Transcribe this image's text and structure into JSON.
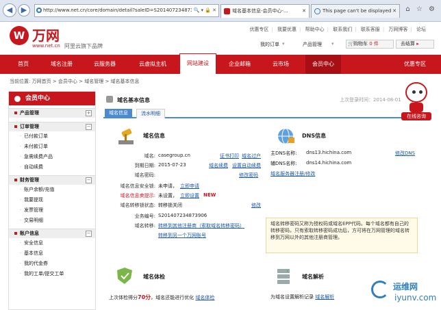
{
  "browser": {
    "url": "http://www.net.cn/core/domain/detail?saleID=S2014072348739",
    "tabs": [
      {
        "label": "域名基本信息-会员中心-..."
      },
      {
        "label": "This page can't be displayed"
      }
    ]
  },
  "header": {
    "brand": "万网",
    "brand_url": "www.net.cn",
    "slogan": "阿里云旗下品牌",
    "top_links": [
      "优惠专区",
      "我要优惠",
      "帮助中心",
      "联系我们",
      "联系客服",
      "万网博客",
      "论坛"
    ],
    "my_order": "我的订单",
    "product_mgmt": "产品管理",
    "cart_label": "购物车",
    "cart_count": "0 件",
    "wallet_label": "去结算"
  },
  "nav": {
    "items": [
      "首页",
      "域名注册",
      "云服务器",
      "云虚拟主机",
      "网站建设",
      "企业邮箱",
      "云市场",
      "会员中心",
      "优惠专区"
    ],
    "active": "网站建设"
  },
  "breadcrumb": "当前位置: 万网首页 > 会员中心 > 域名管理 > 域名基本信息",
  "last_login": "上次登录时间：2014-08-01",
  "sidebar": {
    "title": "会员中心",
    "sections": [
      {
        "label": "产品管理",
        "items": []
      },
      {
        "label": "订单管理",
        "items": [
          "已付款订单",
          "未付款订单",
          "急需续费产品",
          "自动续费"
        ]
      },
      {
        "label": "财务管理",
        "items": [
          "账户余额/充值",
          "我要提现",
          "发票管理",
          "交易明细"
        ]
      },
      {
        "label": "账户信息",
        "items": [
          "安全信息",
          "基本信息",
          "我的代金券",
          "我的工单/提交工单"
        ]
      }
    ]
  },
  "main": {
    "title": "域名基本信息",
    "tabs": [
      "域名信息",
      "流水明细"
    ],
    "domain_panel": {
      "title": "域名信息",
      "rows": [
        {
          "label": "域名:",
          "value": "casegroup.cn"
        },
        {
          "label": "到期日期:",
          "value": "2015-07-23"
        },
        {
          "label": "域名密码:",
          "value": ""
        },
        {
          "label": "域名信息安全锁:",
          "value": "未申请，"
        },
        {
          "label": "域名信息卖提示:",
          "value": "未设置，"
        },
        {
          "label": "域名转移锁状态:",
          "value": "转移锁关闭"
        },
        {
          "label": "业务编号:",
          "value": "S201407234873906"
        },
        {
          "label": "域名转移:",
          "value": ""
        }
      ],
      "links": {
        "cert_print": "证书打印",
        "domain_holder": "域名过户",
        "renew": "域名续费",
        "auto_renew": "设置自动续费",
        "modify_pwd": "修改密码",
        "apply_now": "立即申请",
        "set_now": "立即设置",
        "new_badge": "NEW",
        "modify": "修改",
        "transfer_out": "转移到其他注册商（索取域名转移密码）",
        "transfer_account": "转移到另一个万网账号"
      }
    },
    "dns_panel": {
      "title": "DNS信息",
      "main_dns_label": "主DNS名称:",
      "main_dns": "dns13.hichina.com",
      "aux_dns_label": "辅DNS名称:",
      "aux_dns": "dns14.hichina.com",
      "modify_dns": "修改DNS",
      "server_status": "域名服务器注册/修改"
    },
    "tooltip": "域名转移密码又称为授权码或域名EPP代码。每个域名都有自己的转移密码，只有索取转移密码成功后，方可将在万网管理的域名转移到万网以外的其他注册商管理。",
    "health_panel": {
      "title": "域名体检",
      "text_prefix": "上次体检得分",
      "score": "70分",
      "text_suffix": "，域名还能进行优化",
      "action": "域名体检"
    },
    "resolve_panel": {
      "title": "域名解析",
      "text": "为域名设置解析记录",
      "action": "域名解析"
    }
  },
  "mascot_label": "在线咨询",
  "watermark": {
    "line1": "运维网",
    "line2": "iyunv.com"
  }
}
